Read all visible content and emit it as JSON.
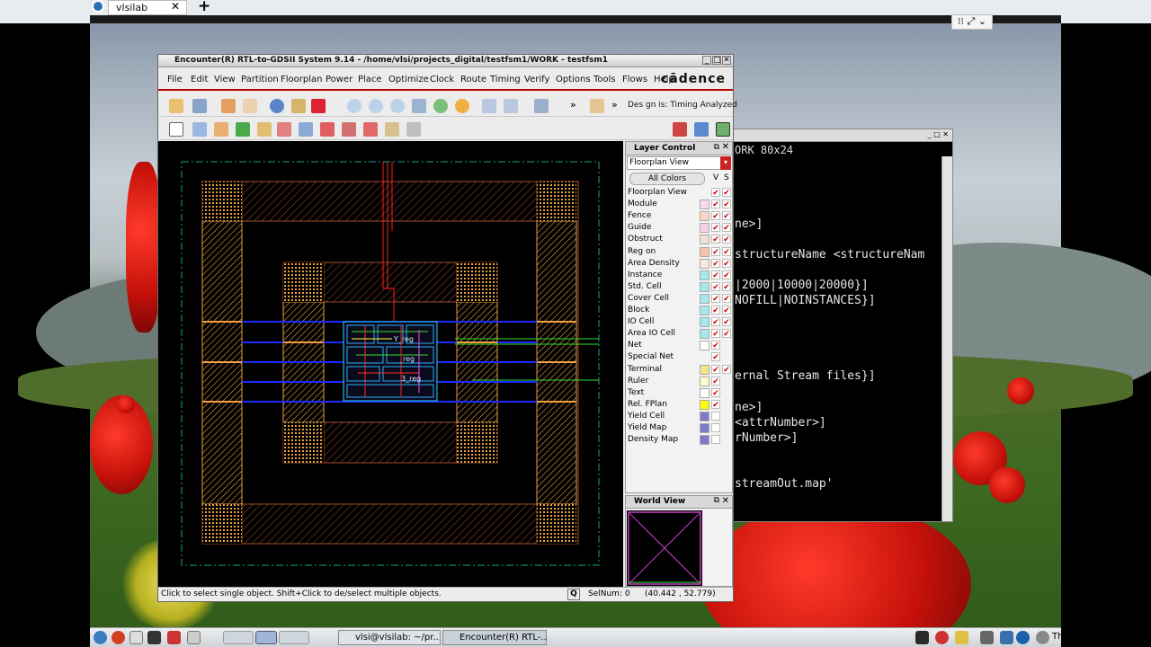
{
  "browser": {
    "tab_title": "vlsilab",
    "tab_close": "✕",
    "new_tab": "+"
  },
  "encounter": {
    "title": "Encounter(R) RTL-to-GDSII System 9.14 - /home/vlsi/projects_digital/testfsm1/WORK - testfsm1",
    "brand": "cādence",
    "menus": [
      "File",
      "Edit",
      "View",
      "Partition",
      "Floorplan",
      "Power",
      "Place",
      "Optimize",
      "Clock",
      "Route",
      "Timing",
      "Verify",
      "Options",
      "Tools",
      "Flows",
      "Help"
    ],
    "design_status": "Des gn is: Timing Analyzed",
    "status_message": "Click to select single object. Shift+Click to de/select multiple objects.",
    "status_q": "Q",
    "selnum": "SelNum: 0",
    "coords": "(40.442 , 52.779)",
    "instances": [
      {
        "label": "Y_reg"
      },
      {
        "label": "_reg"
      },
      {
        "label": "3_reg"
      }
    ]
  },
  "layer_control": {
    "title": "Layer Control",
    "view_select": "Floorplan View",
    "all_colors": "All Colors",
    "col_v": "V",
    "col_s": "S",
    "rows": [
      {
        "label": "Floorplan View",
        "color": "",
        "v": true,
        "s": true
      },
      {
        "label": "Module",
        "color": "#f7d9ef",
        "v": true,
        "s": true
      },
      {
        "label": "Fence",
        "color": "#f9d7c7",
        "v": true,
        "s": true
      },
      {
        "label": "Guide",
        "color": "#f6d0e8",
        "v": true,
        "s": true
      },
      {
        "label": "Obstruct",
        "color": "#f3e0d0",
        "v": true,
        "s": true
      },
      {
        "label": "Reg on",
        "color": "#f8c3a7",
        "v": true,
        "s": true
      },
      {
        "label": "Area Density",
        "color": "#fbe6d8",
        "v": true,
        "s": true
      },
      {
        "label": "Instance",
        "color": "#a6e8ea",
        "v": true,
        "s": true
      },
      {
        "label": "Std. Cell",
        "color": "#a6e8ea",
        "v": true,
        "s": true
      },
      {
        "label": "Cover Cell",
        "color": "#a6e8ea",
        "v": true,
        "s": true
      },
      {
        "label": "Block",
        "color": "#a6e8ea",
        "v": true,
        "s": true
      },
      {
        "label": "IO Cell",
        "color": "#a6e8ea",
        "v": true,
        "s": true
      },
      {
        "label": "Area IO Cell",
        "color": "#a6e8ea",
        "v": true,
        "s": true
      },
      {
        "label": "Net",
        "color": "#ffffff",
        "v": true,
        "s": false
      },
      {
        "label": "Special Net",
        "color": "",
        "v": true,
        "s": false
      },
      {
        "label": "Terminal",
        "color": "#f7e38a",
        "v": true,
        "s": true
      },
      {
        "label": "Ruler",
        "color": "#fdfdc8",
        "v": true,
        "s": false
      },
      {
        "label": "Text",
        "color": "#ffffff",
        "v": true,
        "s": false
      },
      {
        "label": "Rel. FPlan",
        "color": "#ffff00",
        "v": true,
        "s": false
      },
      {
        "label": "Yield Cell",
        "color": "#7d7bc9",
        "v": false,
        "s": false
      },
      {
        "label": "Yield Map",
        "color": "#7d7bc9",
        "v": false,
        "s": false
      },
      {
        "label": "Density Map",
        "color": "#7d7bc9",
        "v": false,
        "s": false
      }
    ]
  },
  "world_view": {
    "title": "World View"
  },
  "terminal": {
    "title": "ORK 80x24",
    "lines": [
      "ne>]",
      "structureName <structureNam",
      "|2000|10000|20000}]",
      "NOFILL|NOINSTANCES}]",
      "ernal Stream files}]",
      "ne>]",
      "<attrNumber>]",
      "rNumber>]",
      "streamOut.map'"
    ]
  },
  "taskbar": {
    "tasks": [
      "vlsi@vlsilab: ~/pr...",
      "Encounter(R) RTL-..."
    ],
    "clock": "Th"
  },
  "colors": {
    "accent": "#b00000",
    "canvas": "#000000",
    "io_orange": "#e8a040",
    "net_blue": "#1a2cff"
  }
}
